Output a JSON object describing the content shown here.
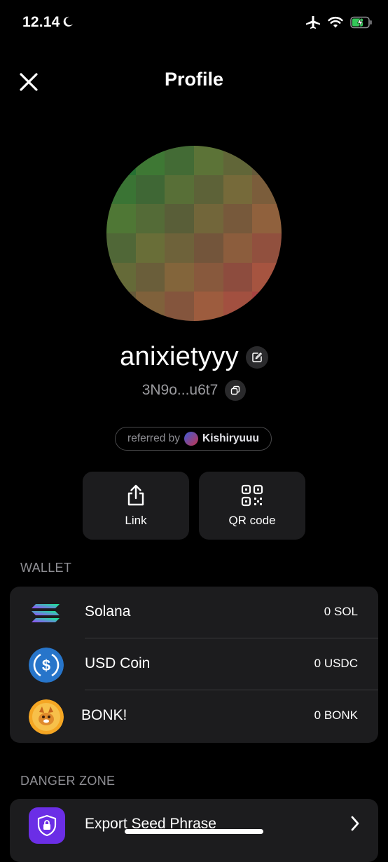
{
  "status_bar": {
    "time": "12.14"
  },
  "header": {
    "title": "Profile"
  },
  "profile": {
    "username": "anixietyyy",
    "address": "3N9o...u6t7",
    "referred_label": "referred by",
    "referrer": "Kishiryuuu"
  },
  "actions": {
    "link_label": "Link",
    "qr_label": "QR code"
  },
  "wallet": {
    "heading": "WALLET",
    "tokens": [
      {
        "name": "Solana",
        "balance": "0 SOL"
      },
      {
        "name": "USD Coin",
        "balance": "0 USDC"
      },
      {
        "name": "BONK!",
        "balance": "0 BONK"
      }
    ]
  },
  "danger_zone": {
    "heading": "DANGER ZONE",
    "export_label": "Export Seed Phrase"
  },
  "colors": {
    "background": "#000000",
    "card": "#1c1c1e",
    "export_accent": "#6b2ee6",
    "usdc_blue": "#2775ca"
  }
}
